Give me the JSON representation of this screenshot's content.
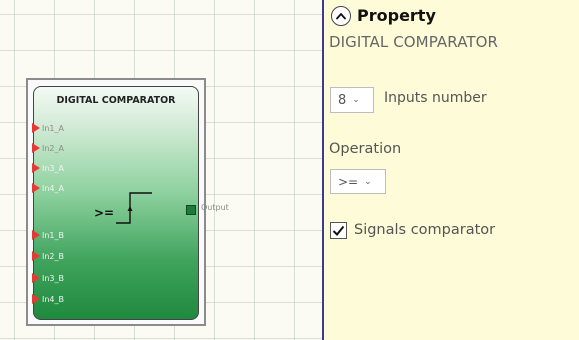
{
  "canvas": {
    "block": {
      "title": "DIGITAL COMPARATOR",
      "inputs": [
        "In1_A",
        "In2_A",
        "In3_A",
        "In4_A",
        "In1_B",
        "In2_B",
        "In3_B",
        "In4_B"
      ],
      "operator_symbol": ">=",
      "output_label": "Output"
    }
  },
  "panel": {
    "title": "Property",
    "collapse_icon": "chevron-up-icon",
    "component_name": "DIGITAL COMPARATOR",
    "inputs_number": {
      "value": "8",
      "label": "Inputs number"
    },
    "operation": {
      "label": "Operation",
      "value": ">="
    },
    "signals_comparator": {
      "label": "Signals comparator",
      "checked": true
    }
  },
  "colors": {
    "panel_bg": "#fdfbd8",
    "pin_red": "#e53935",
    "block_green": "#1f8a3e",
    "divider": "#3b3b8f"
  }
}
